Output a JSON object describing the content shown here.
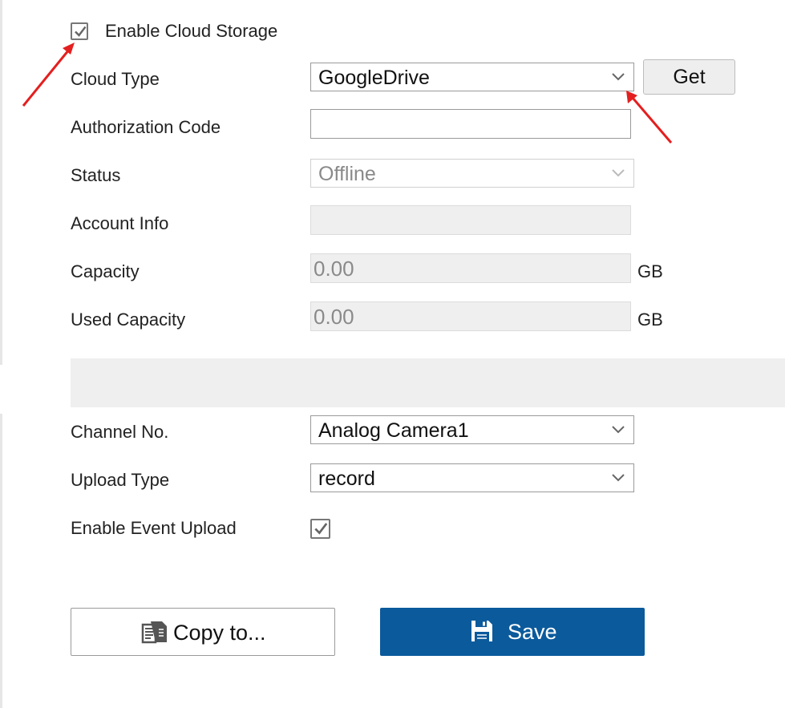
{
  "cloud": {
    "enable_label": "Enable Cloud Storage",
    "enable_checked": true,
    "type_label": "Cloud Type",
    "type_value": "GoogleDrive",
    "get_label": "Get",
    "auth_label": "Authorization Code",
    "auth_value": "",
    "status_label": "Status",
    "status_value": "Offline",
    "account_label": "Account Info",
    "account_value": "",
    "capacity_label": "Capacity",
    "capacity_value": "0.00",
    "capacity_unit": "GB",
    "used_label": "Used Capacity",
    "used_value": "0.00",
    "used_unit": "GB"
  },
  "upload": {
    "channel_label": "Channel No.",
    "channel_value": "Analog Camera1",
    "type_label": "Upload Type",
    "type_value": "record",
    "event_label": "Enable Event Upload",
    "event_checked": true
  },
  "actions": {
    "copy_label": "Copy to...",
    "save_label": "Save"
  },
  "colors": {
    "primary": "#0b5a9c",
    "annotation_arrow": "#e41f1f"
  },
  "icons": [
    "checkmark-icon",
    "chevron-down-icon",
    "copy-icon",
    "save-icon",
    "annotation-arrow"
  ]
}
